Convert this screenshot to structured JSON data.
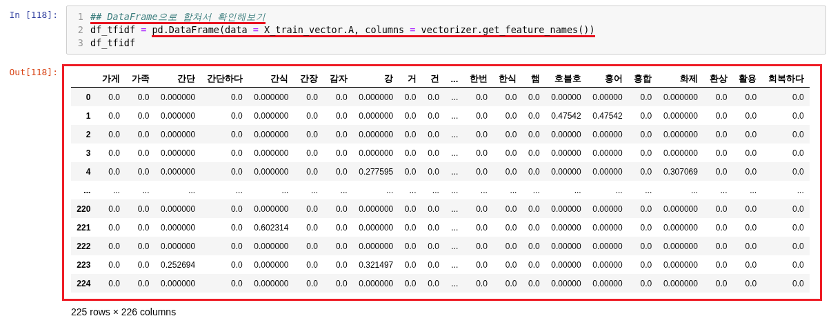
{
  "input_cell": {
    "prompt": "In [118]:",
    "lines": [
      {
        "number": "1",
        "tokens": [
          {
            "kind": "comment",
            "text": "## DataFrame으로 합쳐서 확인해보기",
            "underlined": true
          }
        ]
      },
      {
        "number": "2",
        "tokens": [
          {
            "kind": "plain",
            "text": "df_tfidf ",
            "underlined": false
          },
          {
            "kind": "operator",
            "text": "= ",
            "underlined": false
          },
          {
            "kind": "plain",
            "text": "pd.DataFrame(data ",
            "underlined": true
          },
          {
            "kind": "operator",
            "text": "=",
            "underlined": true
          },
          {
            "kind": "plain",
            "text": " X_train_vector.A, columns ",
            "underlined": true
          },
          {
            "kind": "operator",
            "text": "=",
            "underlined": true
          },
          {
            "kind": "plain",
            "text": " vectorizer.get_feature_names())",
            "underlined": true
          }
        ]
      },
      {
        "number": "3",
        "tokens": [
          {
            "kind": "plain",
            "text": "df_tfidf",
            "underlined": false
          }
        ]
      }
    ]
  },
  "output_cell": {
    "prompt": "Out[118]:",
    "highlighted": true,
    "table": {
      "columns": [
        "가게",
        "가족",
        "간단",
        "간단하다",
        "간식",
        "간장",
        "감자",
        "강",
        "거",
        "건",
        "...",
        "한번",
        "한식",
        "햄",
        "호불호",
        "홍어",
        "홍합",
        "화제",
        "환상",
        "활용",
        "회복하다"
      ],
      "rows": [
        {
          "index": "0",
          "cells": [
            "0.0",
            "0.0",
            "0.000000",
            "0.0",
            "0.000000",
            "0.0",
            "0.0",
            "0.000000",
            "0.0",
            "0.0",
            "...",
            "0.0",
            "0.0",
            "0.0",
            "0.00000",
            "0.00000",
            "0.0",
            "0.000000",
            "0.0",
            "0.0",
            "0.0"
          ]
        },
        {
          "index": "1",
          "cells": [
            "0.0",
            "0.0",
            "0.000000",
            "0.0",
            "0.000000",
            "0.0",
            "0.0",
            "0.000000",
            "0.0",
            "0.0",
            "...",
            "0.0",
            "0.0",
            "0.0",
            "0.47542",
            "0.47542",
            "0.0",
            "0.000000",
            "0.0",
            "0.0",
            "0.0"
          ]
        },
        {
          "index": "2",
          "cells": [
            "0.0",
            "0.0",
            "0.000000",
            "0.0",
            "0.000000",
            "0.0",
            "0.0",
            "0.000000",
            "0.0",
            "0.0",
            "...",
            "0.0",
            "0.0",
            "0.0",
            "0.00000",
            "0.00000",
            "0.0",
            "0.000000",
            "0.0",
            "0.0",
            "0.0"
          ]
        },
        {
          "index": "3",
          "cells": [
            "0.0",
            "0.0",
            "0.000000",
            "0.0",
            "0.000000",
            "0.0",
            "0.0",
            "0.000000",
            "0.0",
            "0.0",
            "...",
            "0.0",
            "0.0",
            "0.0",
            "0.00000",
            "0.00000",
            "0.0",
            "0.000000",
            "0.0",
            "0.0",
            "0.0"
          ]
        },
        {
          "index": "4",
          "cells": [
            "0.0",
            "0.0",
            "0.000000",
            "0.0",
            "0.000000",
            "0.0",
            "0.0",
            "0.277595",
            "0.0",
            "0.0",
            "...",
            "0.0",
            "0.0",
            "0.0",
            "0.00000",
            "0.00000",
            "0.0",
            "0.307069",
            "0.0",
            "0.0",
            "0.0"
          ]
        },
        {
          "index": "...",
          "cells": [
            "...",
            "...",
            "...",
            "...",
            "...",
            "...",
            "...",
            "...",
            "...",
            "...",
            "...",
            "...",
            "...",
            "...",
            "...",
            "...",
            "...",
            "...",
            "...",
            "...",
            "..."
          ]
        },
        {
          "index": "220",
          "cells": [
            "0.0",
            "0.0",
            "0.000000",
            "0.0",
            "0.000000",
            "0.0",
            "0.0",
            "0.000000",
            "0.0",
            "0.0",
            "...",
            "0.0",
            "0.0",
            "0.0",
            "0.00000",
            "0.00000",
            "0.0",
            "0.000000",
            "0.0",
            "0.0",
            "0.0"
          ]
        },
        {
          "index": "221",
          "cells": [
            "0.0",
            "0.0",
            "0.000000",
            "0.0",
            "0.602314",
            "0.0",
            "0.0",
            "0.000000",
            "0.0",
            "0.0",
            "...",
            "0.0",
            "0.0",
            "0.0",
            "0.00000",
            "0.00000",
            "0.0",
            "0.000000",
            "0.0",
            "0.0",
            "0.0"
          ]
        },
        {
          "index": "222",
          "cells": [
            "0.0",
            "0.0",
            "0.000000",
            "0.0",
            "0.000000",
            "0.0",
            "0.0",
            "0.000000",
            "0.0",
            "0.0",
            "...",
            "0.0",
            "0.0",
            "0.0",
            "0.00000",
            "0.00000",
            "0.0",
            "0.000000",
            "0.0",
            "0.0",
            "0.0"
          ]
        },
        {
          "index": "223",
          "cells": [
            "0.0",
            "0.0",
            "0.252694",
            "0.0",
            "0.000000",
            "0.0",
            "0.0",
            "0.321497",
            "0.0",
            "0.0",
            "...",
            "0.0",
            "0.0",
            "0.0",
            "0.00000",
            "0.00000",
            "0.0",
            "0.000000",
            "0.0",
            "0.0",
            "0.0"
          ]
        },
        {
          "index": "224",
          "cells": [
            "0.0",
            "0.0",
            "0.000000",
            "0.0",
            "0.000000",
            "0.0",
            "0.0",
            "0.000000",
            "0.0",
            "0.0",
            "...",
            "0.0",
            "0.0",
            "0.0",
            "0.00000",
            "0.00000",
            "0.0",
            "0.000000",
            "0.0",
            "0.0",
            "0.0"
          ]
        }
      ]
    },
    "shape": "225 rows × 226 columns"
  }
}
